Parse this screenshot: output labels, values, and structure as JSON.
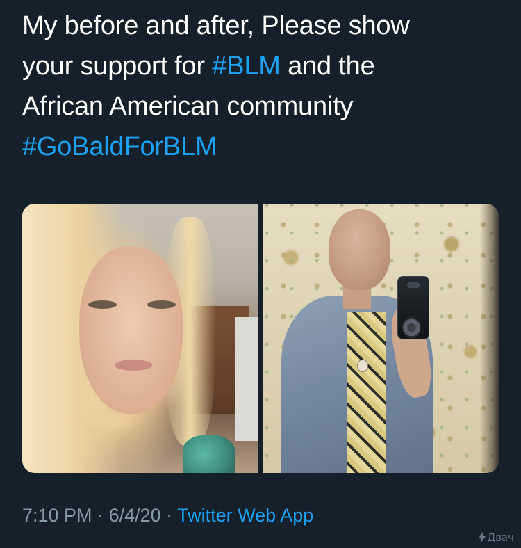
{
  "tweet": {
    "line1": "My before and after, Please show",
    "line2_prefix": "your support for ",
    "hashtag1": "#BLM",
    "line2_suffix": " and the",
    "line3": "African American community",
    "hashtag2": "#GoBaldForBLM"
  },
  "media": {
    "photos": [
      {
        "name": "before-photo"
      },
      {
        "name": "after-photo"
      }
    ]
  },
  "meta": {
    "time": "7:10 PM",
    "separator": " · ",
    "date": "6/4/20",
    "separator2": " · ",
    "source": "Twitter Web App"
  },
  "watermark": {
    "text": "Двач"
  },
  "colors": {
    "background": "#15202b",
    "text": "#ffffff",
    "accent": "#1da1f2",
    "secondary": "#8899a6"
  }
}
